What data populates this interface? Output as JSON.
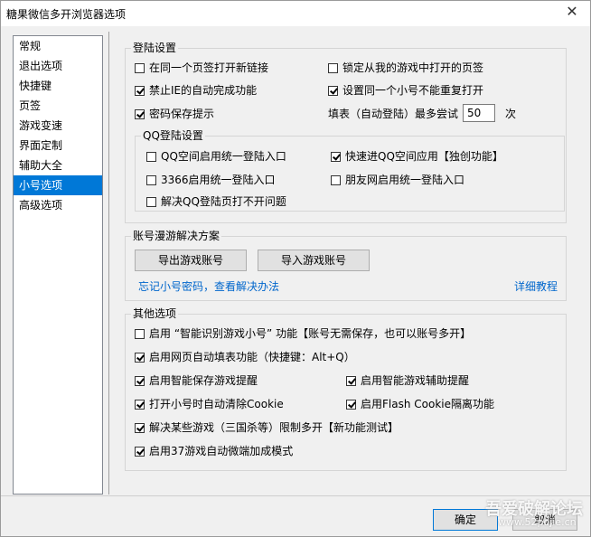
{
  "window": {
    "title": "糖果微信多开浏览器选项"
  },
  "sidebar": {
    "items": [
      {
        "label": "常规"
      },
      {
        "label": "退出选项"
      },
      {
        "label": "快捷键"
      },
      {
        "label": "页签"
      },
      {
        "label": "游戏变速"
      },
      {
        "label": "界面定制"
      },
      {
        "label": "辅助大全"
      },
      {
        "label": "小号选项"
      },
      {
        "label": "高级选项"
      }
    ],
    "selected": "小号选项"
  },
  "login": {
    "legend": "登陆设置",
    "open_new_link": {
      "label": "在同一个页签打开新链接",
      "checked": false
    },
    "lock_game_page": {
      "label": "锁定从我的游戏中打开的页签",
      "checked": false
    },
    "disable_ie_autocomplete": {
      "label": "禁止IE的自动完成功能",
      "checked": true
    },
    "no_duplicate_account": {
      "label": "设置同一个小号不能重复打开",
      "checked": true
    },
    "save_password": {
      "label": "密码保存提示",
      "checked": true
    },
    "fill_retry_label": "填表（自动登陆）最多尝试",
    "fill_retry_value": "50",
    "fill_retry_unit": "次"
  },
  "qq_login": {
    "legend": "QQ登陆设置",
    "qzone_unified": {
      "label": "QQ空间启用统一登陆入口",
      "checked": false
    },
    "qzone_fast": {
      "label": "快速进QQ空间应用【独创功能】",
      "checked": true
    },
    "c3366_unified": {
      "label": "3366启用统一登陆入口",
      "checked": false
    },
    "pengyou_unified": {
      "label": "朋友网启用统一登陆入口",
      "checked": false
    },
    "fix_qq_login": {
      "label": "解决QQ登陆页打不开问题",
      "checked": false
    }
  },
  "roaming": {
    "legend": "账号漫游解决方案",
    "export_btn": "导出游戏账号",
    "import_btn": "导入游戏账号",
    "forgot_link": "忘记小号密码，查看解决办法",
    "tutorial_link": "详细教程"
  },
  "other": {
    "legend": "其他选项",
    "smart_identify": {
      "label": "启用 “智能识别游戏小号” 功能【账号无需保存，也可以账号多开】",
      "checked": false
    },
    "auto_fill": {
      "label": "启用网页自动填表功能（快捷键：Alt+Q）",
      "checked": true
    },
    "smart_save_remind": {
      "label": "启用智能保存游戏提醒",
      "checked": true
    },
    "smart_assist_remind": {
      "label": "启用智能游戏辅助提醒",
      "checked": true
    },
    "clear_cookie": {
      "label": "打开小号时自动清除Cookie",
      "checked": true
    },
    "flash_cookie_isolation": {
      "label": "启用Flash Cookie隔离功能",
      "checked": true
    },
    "unlock_multi": {
      "label": "解决某些游戏（三国杀等）限制多开【新功能测试】",
      "checked": true
    },
    "microclient_37": {
      "label": "启用37游戏自动微端加成模式",
      "checked": true
    }
  },
  "footer": {
    "ok": "确定",
    "cancel": "取消"
  },
  "watermark": {
    "line1": "吾爱破解论坛",
    "line2": "www.52pojie.cn"
  }
}
